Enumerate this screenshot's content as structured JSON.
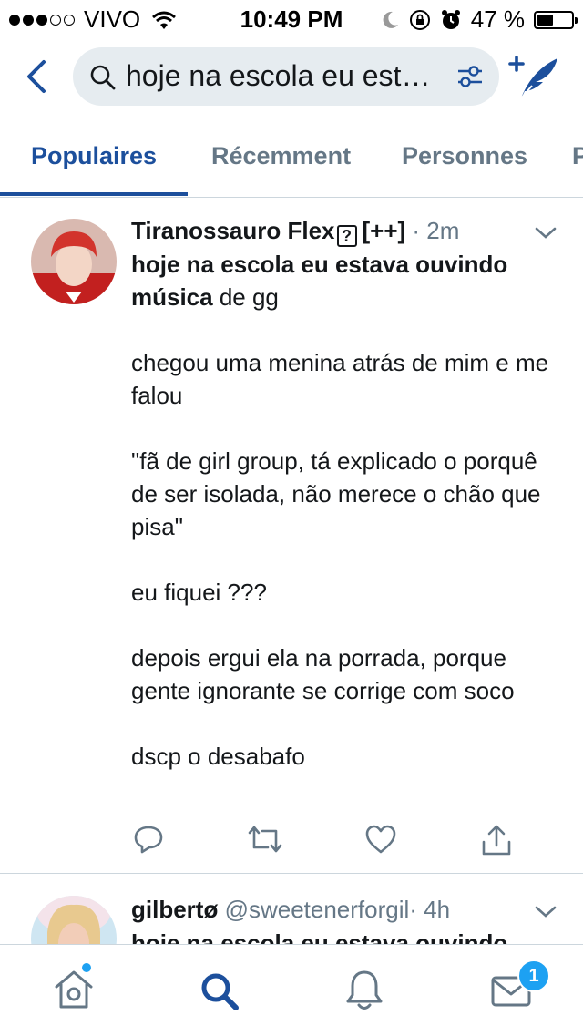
{
  "status_bar": {
    "carrier": "VIVO",
    "time": "10:49 PM",
    "battery": "47 %",
    "battery_level": 0.47
  },
  "search": {
    "query": "hoje na escola eu estava ouvindo música de gg"
  },
  "tabs": [
    {
      "label": "Populaires"
    },
    {
      "label": "Récemment"
    },
    {
      "label": "Personnes"
    },
    {
      "label": "P"
    }
  ],
  "tweets": [
    {
      "display_name": "Tiranossauro Flex",
      "name_suffix": "[++]",
      "time": "· 2m",
      "highlight": "hoje na escola eu estava ouvindo música",
      "text_after_highlight": " de gg",
      "paragraphs": [
        "chegou uma menina atrás de mim e me falou",
        "\"fã de girl group, tá explicado o porquê de ser isolada, não merece o chão que pisa\"",
        "eu fiquei ???",
        "depois ergui ela na porrada, porque gente ignorante se corrige com soco",
        "dscp o desabafo"
      ]
    },
    {
      "display_name": "gilbertø",
      "handle": "@sweetenerforgil",
      "time": "· 4h",
      "highlight": "hoje na escola eu estava ouvindo"
    }
  ],
  "tab_bar": {
    "messages_badge": "1"
  },
  "colors": {
    "accent": "#1c4f9c",
    "link_blue": "#1da1f2",
    "secondary_text": "#657786",
    "search_bg": "#e6ecf0"
  }
}
